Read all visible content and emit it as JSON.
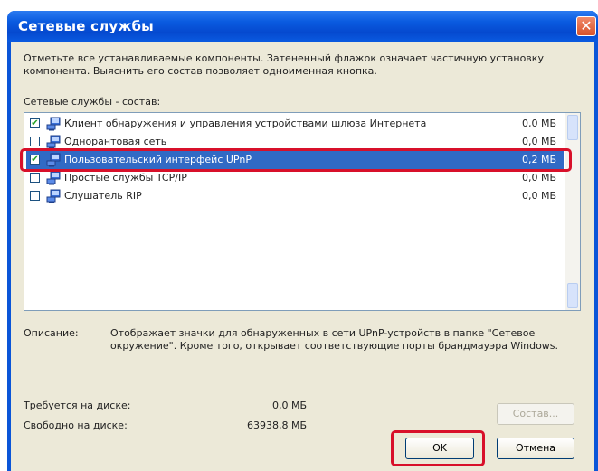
{
  "window": {
    "title": "Сетевые службы",
    "close_icon": "close-icon"
  },
  "instructions": "Отметьте все устанавливаемые компоненты. Затененный флажок означает частичную установку компонента. Выяснить его состав позволяет одноименная кнопка.",
  "components_label": "Сетевые службы - состав:",
  "components": [
    {
      "name": "Клиент обнаружения и управления устройствами шлюза Интернета",
      "size": "0,0 МБ",
      "checked": true,
      "selected": false
    },
    {
      "name": "Однорантовая сеть",
      "size": "0,0 МБ",
      "checked": false,
      "selected": false
    },
    {
      "name": "Пользовательский интерфейс UPnP",
      "size": "0,2 МБ",
      "checked": true,
      "selected": true
    },
    {
      "name": "Простые службы TCP/IP",
      "size": "0,0 МБ",
      "checked": false,
      "selected": false
    },
    {
      "name": "Слушатель RIP",
      "size": "0,0 МБ",
      "checked": false,
      "selected": false
    }
  ],
  "description": {
    "label": "Описание:",
    "text": "Отображает значки для обнаруженных в сети UPnP-устройств в папке \"Сетевое окружение\". Кроме того, открывает соответствующие порты брандмауэра Windows."
  },
  "disk": {
    "required_label": "Требуется на диске:",
    "required_value": "0,0 МБ",
    "free_label": "Свободно на диске:",
    "free_value": "63938,8 МБ"
  },
  "buttons": {
    "details": "Состав...",
    "ok": "OK",
    "cancel": "Отмена"
  },
  "colors": {
    "title_bar": "#0a55d8",
    "selection": "#316ac5",
    "highlight_annotation": "#d8102a"
  }
}
